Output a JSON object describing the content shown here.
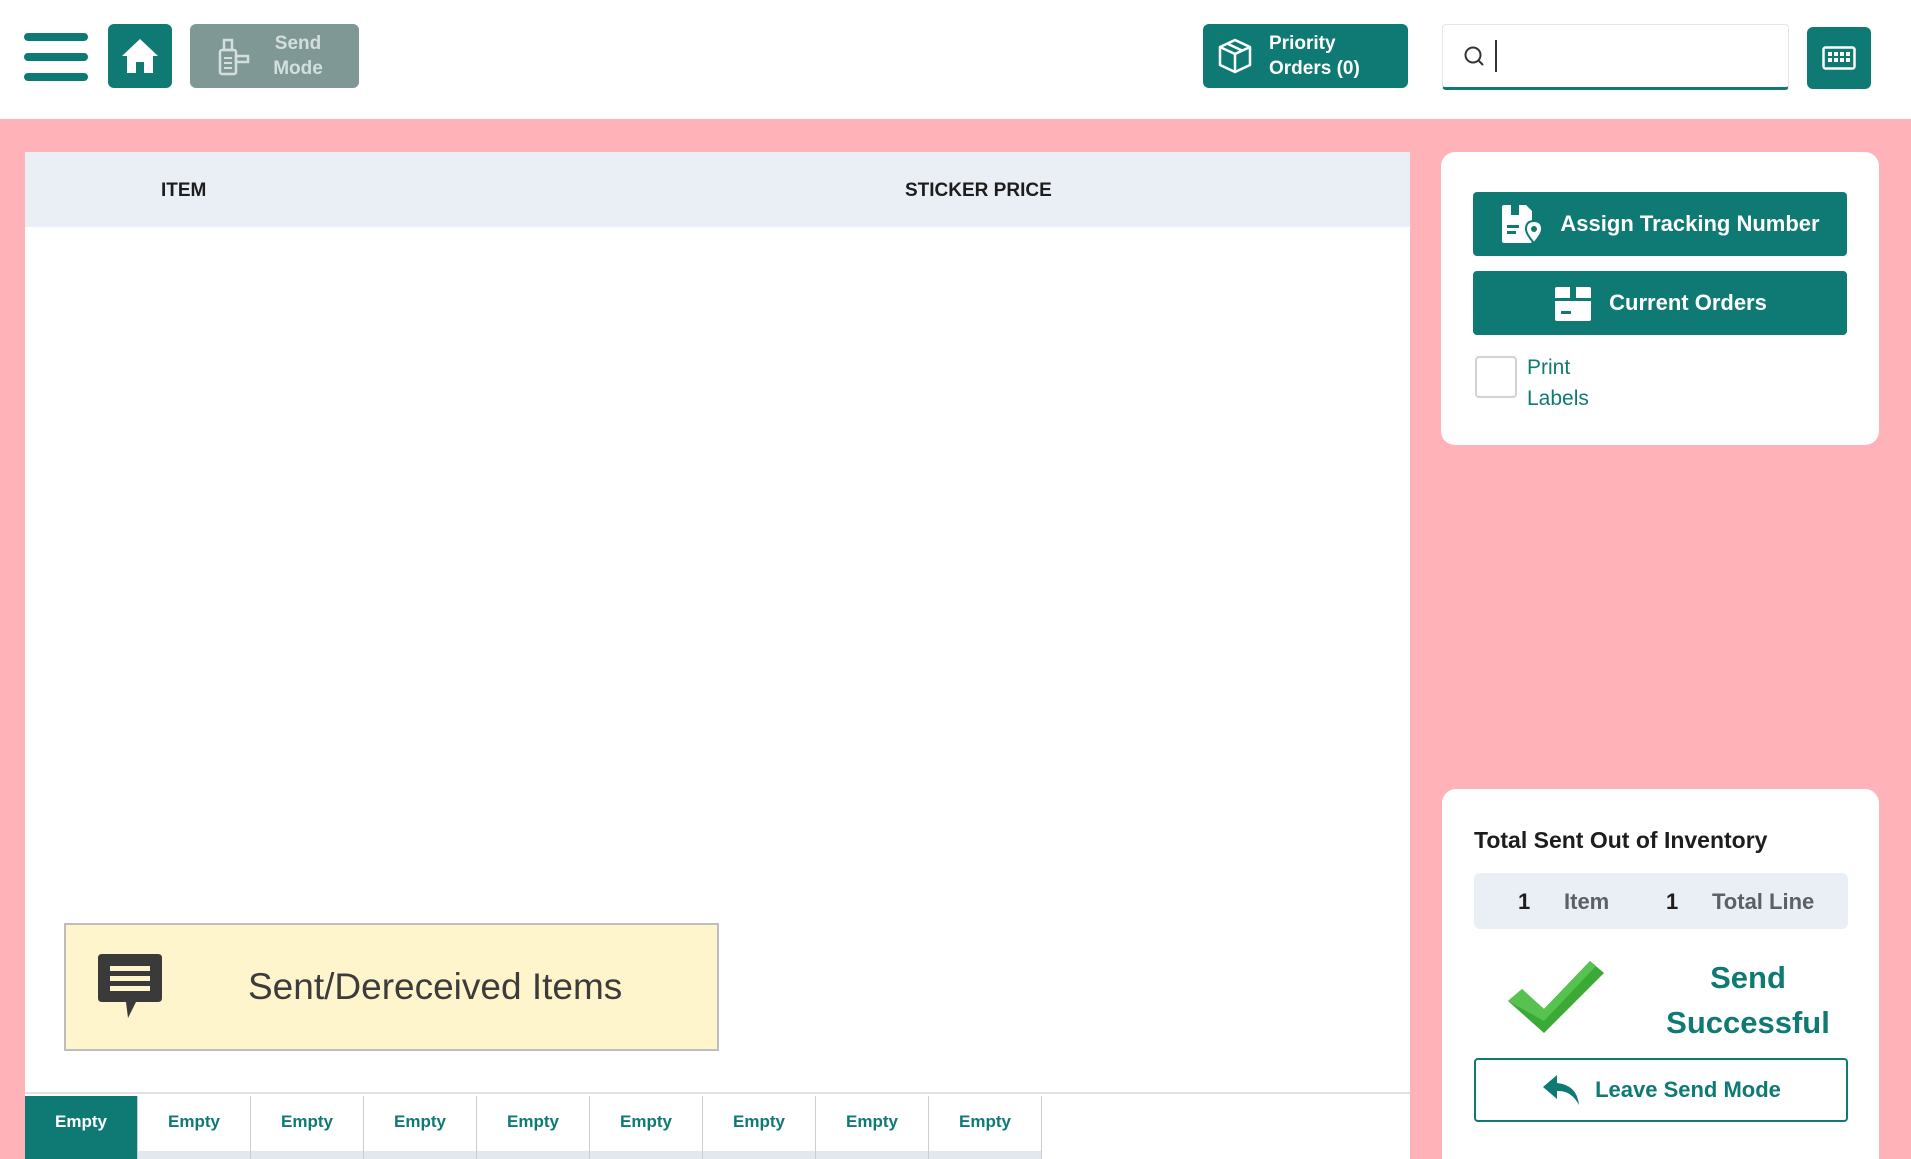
{
  "colors": {
    "accent": "#0f7a74",
    "page_background": "#ffb2b7",
    "disabled_button": "#7f9895",
    "table_header": "#eaeef5",
    "banner_background": "#fff5cc",
    "success_check": "#3aa935"
  },
  "header": {
    "menu_icon": "hamburger-menu-icon",
    "home_icon": "home-icon",
    "send_mode": {
      "icon": "scanner-icon",
      "label_line1": "Send",
      "label_line2": "Mode"
    },
    "priority_orders": {
      "icon": "package-box-icon",
      "label_line1": "Priority",
      "label_line2": "Orders (0)"
    },
    "search": {
      "icon": "search-icon",
      "value": "",
      "placeholder": ""
    },
    "keyboard_icon": "keyboard-icon"
  },
  "table": {
    "columns": [
      "ITEM",
      "STICKER PRICE"
    ],
    "rows": []
  },
  "banner": {
    "icon": "message-icon",
    "text": "Sent/Dereceived Items"
  },
  "tabs": [
    {
      "label": "Empty",
      "active": true
    },
    {
      "label": "Empty",
      "active": false
    },
    {
      "label": "Empty",
      "active": false
    },
    {
      "label": "Empty",
      "active": false
    },
    {
      "label": "Empty",
      "active": false
    },
    {
      "label": "Empty",
      "active": false
    },
    {
      "label": "Empty",
      "active": false
    },
    {
      "label": "Empty",
      "active": false
    },
    {
      "label": "Empty",
      "active": false
    }
  ],
  "actions": {
    "assign_tracking": {
      "icon": "tracking-label-icon",
      "label": "Assign Tracking Number"
    },
    "current_orders": {
      "icon": "box-icon",
      "label": "Current Orders"
    },
    "print_labels": {
      "checked": false,
      "label_line1": "Print",
      "label_line2": "Labels"
    }
  },
  "summary": {
    "title": "Total Sent Out of Inventory",
    "item_count": "1",
    "item_label": "Item",
    "line_count": "1",
    "line_label": "Total Line",
    "status_icon": "checkmark-icon",
    "status_line1": "Send",
    "status_line2": "Successful",
    "leave_button": {
      "icon": "undo-arrow-icon",
      "label": "Leave Send Mode"
    }
  }
}
